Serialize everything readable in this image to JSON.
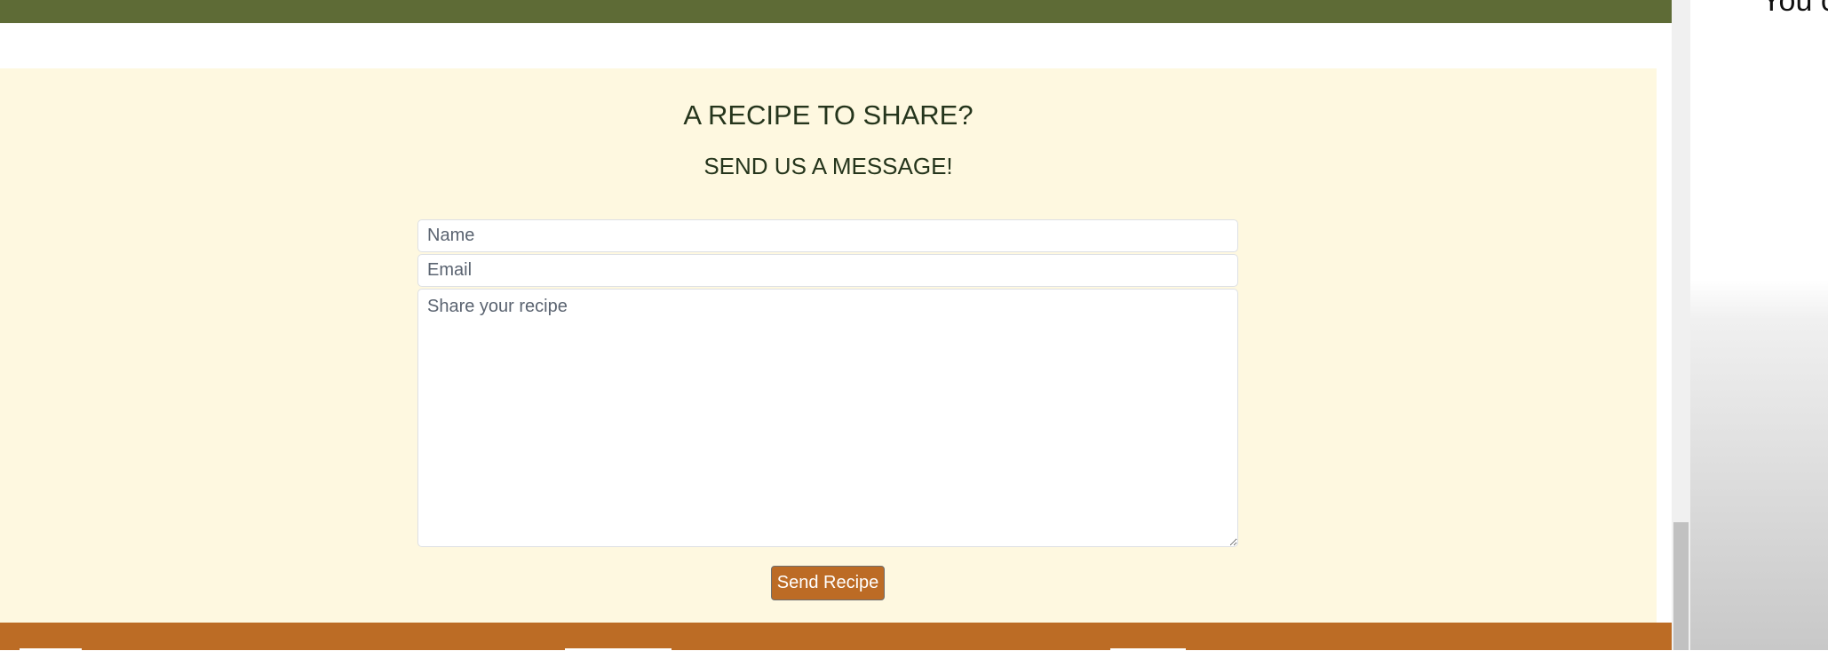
{
  "colors": {
    "header": "#5e6b36",
    "section_bg": "#fef8e0",
    "accent": "#bc6b25",
    "heading": "#25351c"
  },
  "contact": {
    "title": "A RECIPE TO SHARE?",
    "subtitle": "SEND US A MESSAGE!",
    "name_placeholder": "Name",
    "email_placeholder": "Email",
    "message_placeholder": "Share your recipe",
    "submit_label": "Send Recipe"
  },
  "side_panel": {
    "text": "You c"
  }
}
